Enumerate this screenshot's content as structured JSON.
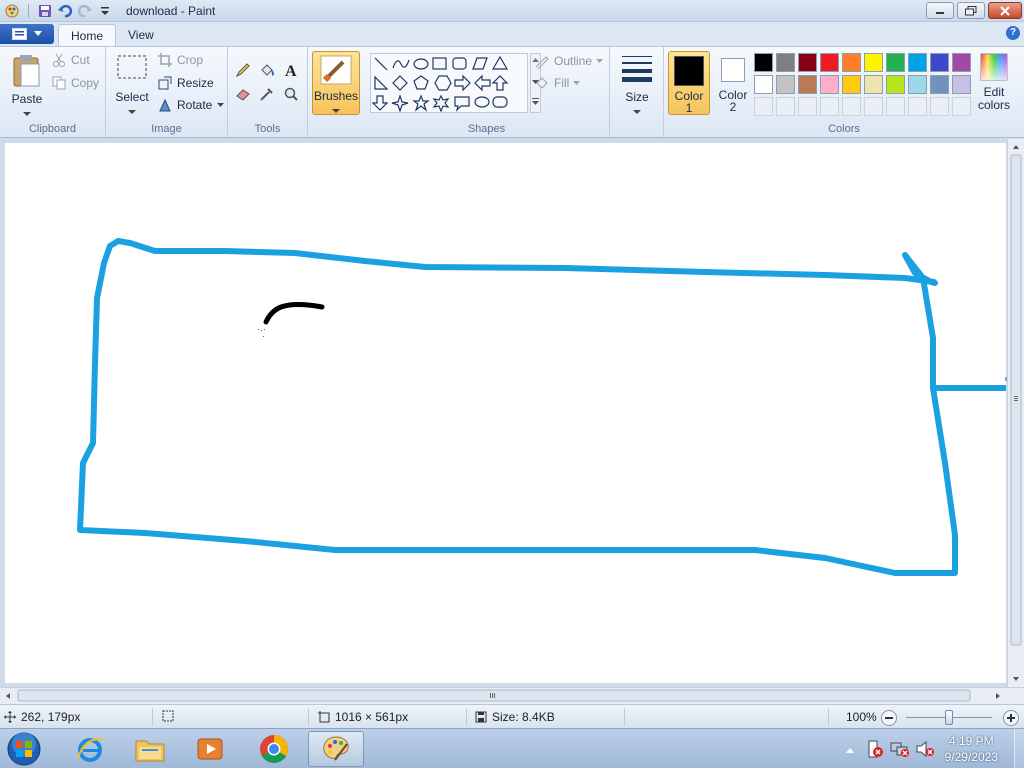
{
  "window": {
    "title": "download - Paint"
  },
  "tabs": {
    "home": "Home",
    "view": "View"
  },
  "clipboard": {
    "paste": "Paste",
    "cut": "Cut",
    "copy": "Copy",
    "group": "Clipboard"
  },
  "image": {
    "select": "Select",
    "crop": "Crop",
    "resize": "Resize",
    "rotate": "Rotate",
    "group": "Image"
  },
  "tools": {
    "group": "Tools"
  },
  "brushes": {
    "label": "Brushes"
  },
  "shapes": {
    "outline": "Outline",
    "fill": "Fill",
    "group": "Shapes"
  },
  "size": {
    "label": "Size"
  },
  "colors": {
    "color1_label": "Color",
    "color1_num": "1",
    "color2_label": "Color",
    "color2_num": "2",
    "edit_label1": "Edit",
    "edit_label2": "colors",
    "group": "Colors",
    "color1": "#000000",
    "color2": "#ffffff",
    "palette_row1": [
      "#000000",
      "#7f7f7f",
      "#880015",
      "#ed1c24",
      "#ff7f27",
      "#fff200",
      "#22b14c",
      "#00a2e8",
      "#3f48cc",
      "#a349a4"
    ],
    "palette_row2": [
      "#ffffff",
      "#c3c3c3",
      "#b97a57",
      "#ffaec9",
      "#ffc90e",
      "#efe4b0",
      "#b5e61d",
      "#99d9ea",
      "#7092be",
      "#c8bfe7"
    ]
  },
  "status": {
    "position": "262, 179px",
    "dimensions": "1016 × 561px",
    "file_size": "Size: 8.4KB",
    "zoom": "100%"
  },
  "taskbar": {
    "time": "4:19 PM",
    "date": "9/29/2023"
  },
  "drawing": {
    "stroke_blue": "#1ba1e2",
    "stroke_black": "#000000"
  }
}
